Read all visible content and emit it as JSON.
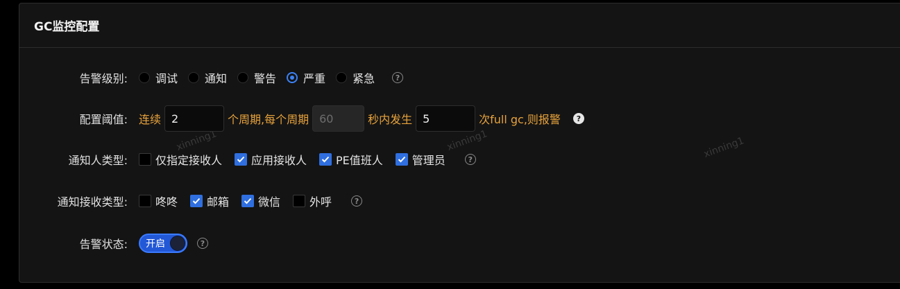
{
  "card": {
    "title": "GC监控配置"
  },
  "watermark": "xinning1",
  "alert_level": {
    "label": "告警级别:",
    "options": [
      "调试",
      "通知",
      "警告",
      "严重",
      "紧急"
    ],
    "selected": "严重"
  },
  "threshold": {
    "label": "配置阈值:",
    "prefix": "连续",
    "consecutive": "2",
    "mid": "个周期,每个周期",
    "period_seconds": "60",
    "suffix1": "秒内发生",
    "count": "5",
    "suffix2": "次full gc,则报警"
  },
  "notify_people": {
    "label": "通知人类型:",
    "options": [
      {
        "text": "仅指定接收人",
        "checked": false
      },
      {
        "text": "应用接收人",
        "checked": true
      },
      {
        "text": "PE值班人",
        "checked": true
      },
      {
        "text": "管理员",
        "checked": true
      }
    ]
  },
  "notify_channels": {
    "label": "通知接收类型:",
    "options": [
      {
        "text": "咚咚",
        "checked": false
      },
      {
        "text": "邮箱",
        "checked": true
      },
      {
        "text": "微信",
        "checked": true
      },
      {
        "text": "外呼",
        "checked": false
      }
    ]
  },
  "alert_status": {
    "label": "告警状态:",
    "switch_text": "开启",
    "on": true
  },
  "help_glyph": "?"
}
